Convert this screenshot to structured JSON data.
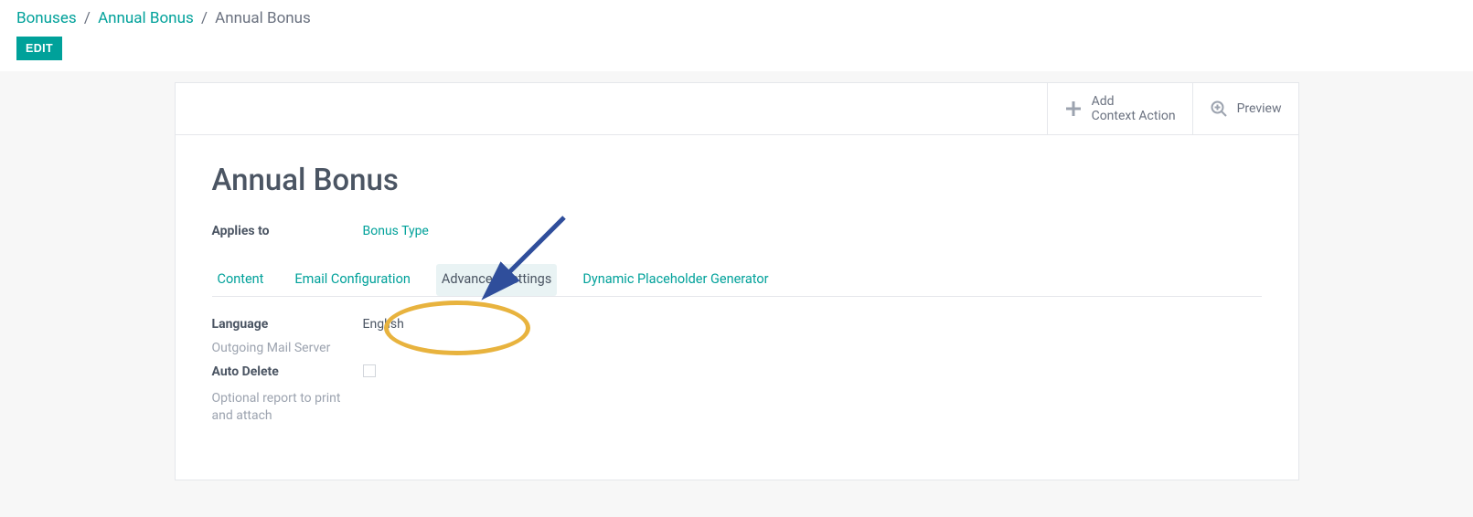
{
  "breadcrumb": {
    "items": [
      "Bonuses",
      "Annual Bonus"
    ],
    "current": "Annual Bonus",
    "separator": "/"
  },
  "buttons": {
    "edit": "EDIT",
    "add_context": "Add\nContext Action",
    "preview": "Preview"
  },
  "page": {
    "title": "Annual Bonus",
    "applies_to_label": "Applies to",
    "applies_to_value": "Bonus Type"
  },
  "tabs": {
    "content": "Content",
    "email_config": "Email Configuration",
    "advanced": "Advanced Settings",
    "dpg": "Dynamic Placeholder Generator"
  },
  "fields": {
    "language_label": "Language",
    "language_value": "English",
    "outgoing_label": "Outgoing Mail Server",
    "auto_delete_label": "Auto Delete",
    "optional_report_label": "Optional report to print and attach"
  }
}
